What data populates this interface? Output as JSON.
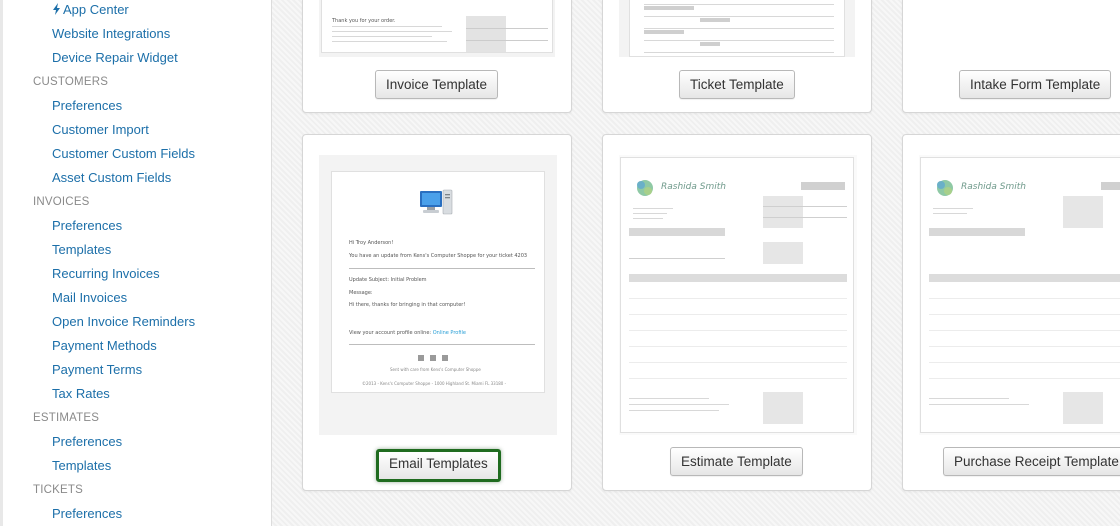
{
  "sidebar": {
    "items": [
      {
        "kind": "link",
        "label": "App Center",
        "icon": "bolt-icon"
      },
      {
        "kind": "link",
        "label": "Website Integrations"
      },
      {
        "kind": "link",
        "label": "Device Repair Widget"
      },
      {
        "kind": "heading",
        "label": "CUSTOMERS"
      },
      {
        "kind": "link",
        "label": "Preferences"
      },
      {
        "kind": "link",
        "label": "Customer Import"
      },
      {
        "kind": "link",
        "label": "Customer Custom Fields"
      },
      {
        "kind": "link",
        "label": "Asset Custom Fields"
      },
      {
        "kind": "heading",
        "label": "INVOICES"
      },
      {
        "kind": "link",
        "label": "Preferences"
      },
      {
        "kind": "link",
        "label": "Templates"
      },
      {
        "kind": "link",
        "label": "Recurring Invoices"
      },
      {
        "kind": "link",
        "label": "Mail Invoices"
      },
      {
        "kind": "link",
        "label": "Open Invoice Reminders"
      },
      {
        "kind": "link",
        "label": "Payment Methods"
      },
      {
        "kind": "link",
        "label": "Payment Terms"
      },
      {
        "kind": "link",
        "label": "Tax Rates"
      },
      {
        "kind": "heading",
        "label": "ESTIMATES"
      },
      {
        "kind": "link",
        "label": "Preferences"
      },
      {
        "kind": "link",
        "label": "Templates"
      },
      {
        "kind": "heading",
        "label": "TICKETS"
      },
      {
        "kind": "link",
        "label": "Preferences"
      }
    ]
  },
  "cards": {
    "invoice": {
      "button": "Invoice Template"
    },
    "ticket": {
      "button": "Ticket Template"
    },
    "intake": {
      "button": "Intake Form Template"
    },
    "email": {
      "button": "Email Templates",
      "preview": {
        "greeting": "Hi Troy Anderson!",
        "line1": "You have an update from Kens's Computer Shoppe for your ticket 4203",
        "subject": "Update Subject: Initial Problem",
        "message_label": "Message:",
        "message": "Hi there, thanks for bringing in that computer!",
        "profile_text": "View your account profile online:",
        "profile_link": "Online Profile",
        "footer1": "Sent with care from Kens's Computer Shoppe",
        "footer2": "©2013 - Kens's Computer Shoppe - 1000 Highland St. Miami FL 33180 -"
      }
    },
    "estimate": {
      "button": "Estimate Template",
      "brand": "Rashida Smith"
    },
    "receipt": {
      "button": "Purchase Receipt Template",
      "brand": "Rashida Smith"
    }
  },
  "colors": {
    "link": "#1c6fa9",
    "heading": "#8a8a8a",
    "active_button_border": "#1f6b1f"
  }
}
